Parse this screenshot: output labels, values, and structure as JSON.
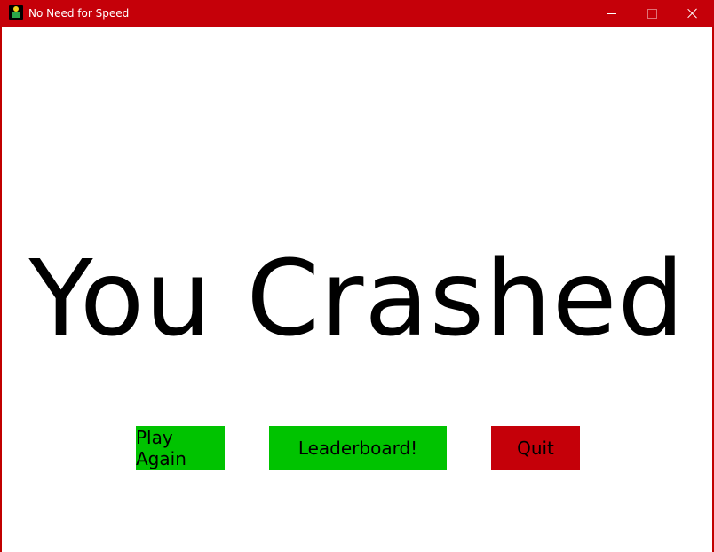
{
  "window": {
    "title": "No Need for Speed",
    "icon": "game-app-icon",
    "controls": {
      "minimize_icon": "minimize-icon",
      "maximize_icon": "maximize-icon",
      "close_icon": "close-icon"
    }
  },
  "screen": {
    "headline": "You Crashed",
    "buttons": {
      "play_again": "Play Again",
      "leaderboard": "Leaderboard!",
      "quit": "Quit"
    }
  },
  "colors": {
    "titlebar": "#c50009",
    "play_again_button": "#00c300",
    "leaderboard_button": "#00c300",
    "quit_button": "#c50009",
    "background": "#ffffff"
  }
}
